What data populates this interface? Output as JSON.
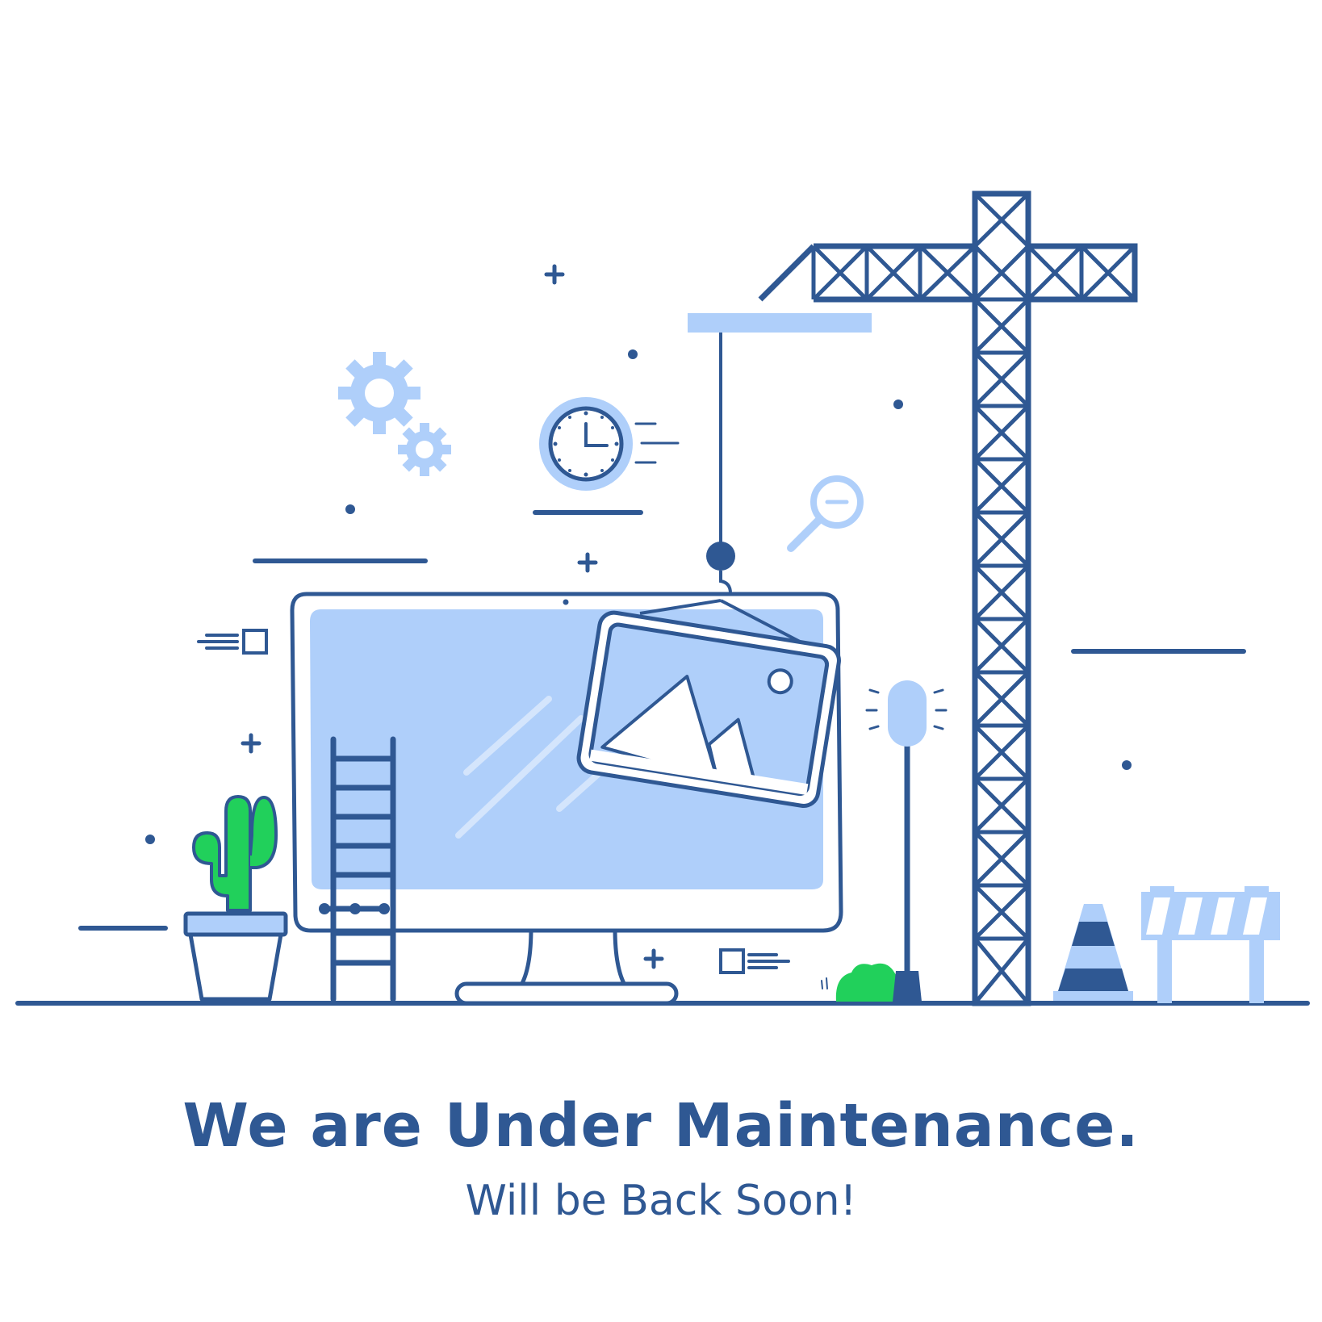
{
  "page": {
    "title": "We are Under Maintenance.",
    "subtitle": "Will be Back Soon!"
  },
  "colors": {
    "primary": "#2f5893",
    "light": "#afcffa",
    "green": "#21d05b",
    "background": "#ffffff"
  },
  "icons": [
    "gear-icon",
    "clock-icon",
    "magnifier-icon",
    "image-icon",
    "crane-icon",
    "ladder-icon",
    "cactus-icon",
    "traffic-cone-icon",
    "barrier-icon",
    "warning-light-icon",
    "monitor-icon",
    "bush-icon"
  ]
}
